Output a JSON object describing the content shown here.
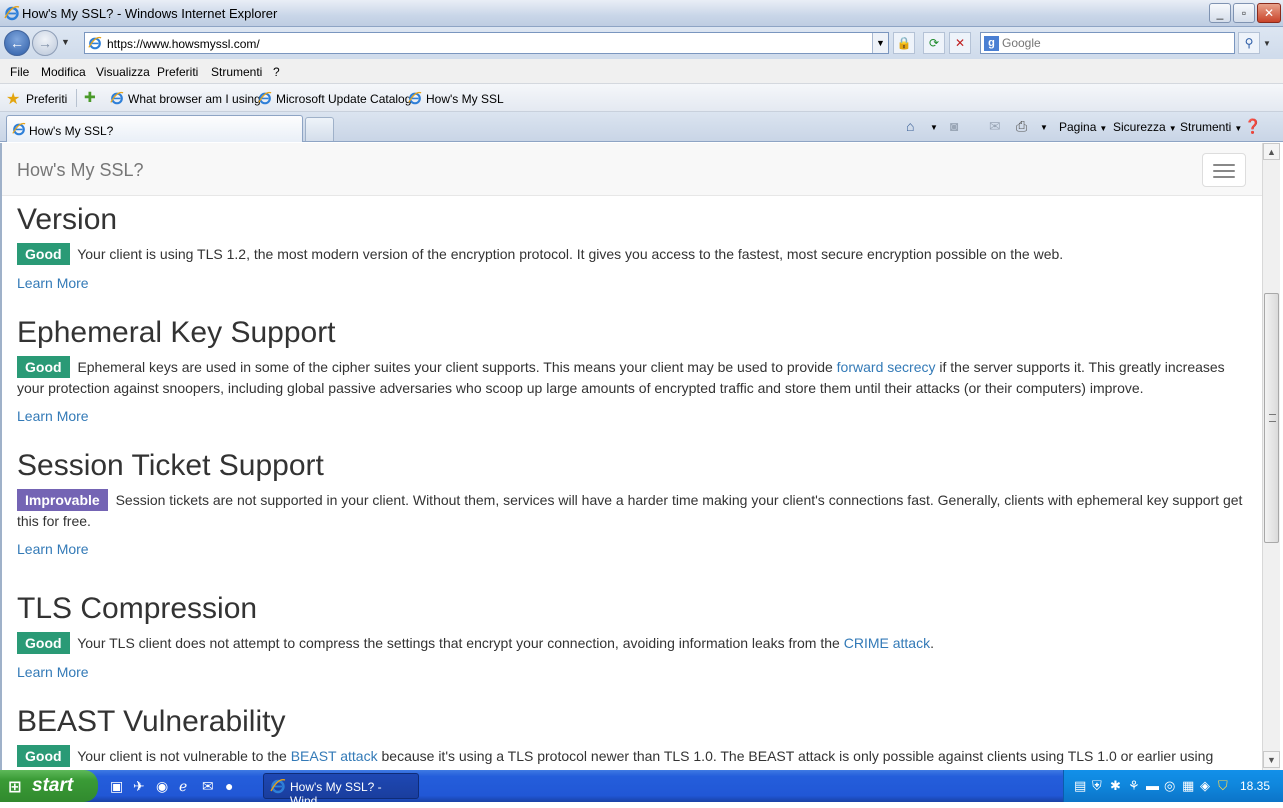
{
  "window": {
    "title": "How's My SSL? - Windows Internet Explorer"
  },
  "toolbar": {
    "url": "https://www.howsmyssl.com/",
    "search_placeholder": "Google"
  },
  "menu": {
    "items": [
      "File",
      "Modifica",
      "Visualizza",
      "Preferiti",
      "Strumenti",
      "?"
    ]
  },
  "favorites": {
    "label": "Preferiti",
    "links": [
      "What browser am I using",
      "Microsoft Update Catalog",
      "How's My SSL"
    ]
  },
  "tabs": {
    "active_label": "How's My SSL?",
    "commands": [
      "Pagina",
      "Sicurezza",
      "Strumenti"
    ]
  },
  "page": {
    "brand": "How's My SSL?",
    "learn_more": "Learn More",
    "sections": [
      {
        "heading": "Version",
        "rating": "Good",
        "text": "Your client is using TLS 1.2, the most modern version of the encryption protocol. It gives you access to the fastest, most secure encryption possible on the web."
      },
      {
        "heading": "Ephemeral Key Support",
        "rating": "Good",
        "text_before": "Ephemeral keys are used in some of the cipher suites your client supports. This means your client may be used to provide ",
        "link": "forward secrecy",
        "text_after": " if the server supports it. This greatly increases your protection against snoopers, including global passive adversaries who scoop up large amounts of encrypted traffic and store them until their attacks (or their computers) improve."
      },
      {
        "heading": "Session Ticket Support",
        "rating": "Improvable",
        "text": "Session tickets are not supported in your client. Without them, services will have a harder time making your client's connections fast. Generally, clients with ephemeral key support get this for free."
      },
      {
        "heading": "TLS Compression",
        "rating": "Good",
        "text_before": "Your TLS client does not attempt to compress the settings that encrypt your connection, avoiding information leaks from the ",
        "link": "CRIME attack",
        "text_after": "."
      },
      {
        "heading": "BEAST Vulnerability",
        "rating": "Good",
        "text_before": "Your client is not vulnerable to the ",
        "link": "BEAST attack",
        "text_after": " because it's using a TLS protocol newer than TLS 1.0. The BEAST attack is only possible against clients using TLS 1.0 or earlier using"
      }
    ]
  },
  "taskbar": {
    "start_label": "start",
    "task_label": "How's My SSL? - Wind...",
    "clock": "18.35"
  },
  "colors": {
    "good": "#2a9a76",
    "improvable": "#7464b4",
    "link": "#337ab7"
  }
}
